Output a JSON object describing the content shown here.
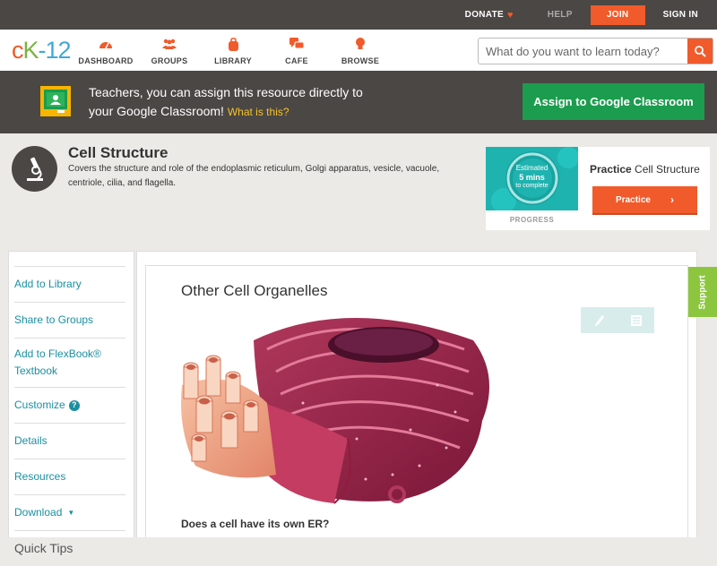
{
  "topbar": {
    "donate": "DONATE",
    "help": "HELP",
    "join": "JOIN",
    "signin": "SIGN IN"
  },
  "nav": {
    "logo": {
      "c": "c",
      "k": "K",
      "n": "-12"
    },
    "items": [
      {
        "label": "DASHBOARD",
        "icon": "dashboard-gauge-icon"
      },
      {
        "label": "GROUPS",
        "icon": "groups-people-icon"
      },
      {
        "label": "LIBRARY",
        "icon": "library-bag-icon"
      },
      {
        "label": "CAFE",
        "icon": "cafe-chat-icon"
      },
      {
        "label": "BROWSE",
        "icon": "browse-bulb-icon"
      }
    ],
    "search_placeholder": "What do you want to learn today?"
  },
  "banner": {
    "line1": "Teachers, you can assign this resource directly to",
    "line2": "your Google Classroom!",
    "what_link": "What is this?",
    "assign_button": "Assign to Google Classroom"
  },
  "concept": {
    "title": "Cell Structure",
    "description": "Covers the structure and role of the endoplasmic reticulum, Golgi apparatus, vesicle, vacuole, centriole, cilia, and flagella."
  },
  "practice_card": {
    "estimate_line1": "Estimated",
    "estimate_line2": "5 mins",
    "estimate_line3": "to complete",
    "progress_label": "PROGRESS",
    "title_bold": "Practice",
    "title_rest": "Cell Structure",
    "button": "Practice"
  },
  "sidebar": {
    "items": [
      {
        "label": "Add to Library"
      },
      {
        "label": "Share to Groups"
      },
      {
        "label": "Add to FlexBook® Textbook"
      },
      {
        "label": "Customize"
      },
      {
        "label": "Details"
      },
      {
        "label": "Resources"
      },
      {
        "label": "Download"
      },
      {
        "label": "Quick Tips"
      }
    ]
  },
  "main": {
    "section_title": "Other Cell Organelles",
    "question": "Does a cell have its own ER?"
  },
  "support_tab": "Support",
  "colors": {
    "accent_orange": "#f15a2b",
    "dark_bar": "#4a4744",
    "google_green": "#1c9c4e",
    "link_teal": "#1a8fa0",
    "support_green": "#8cc63f"
  }
}
